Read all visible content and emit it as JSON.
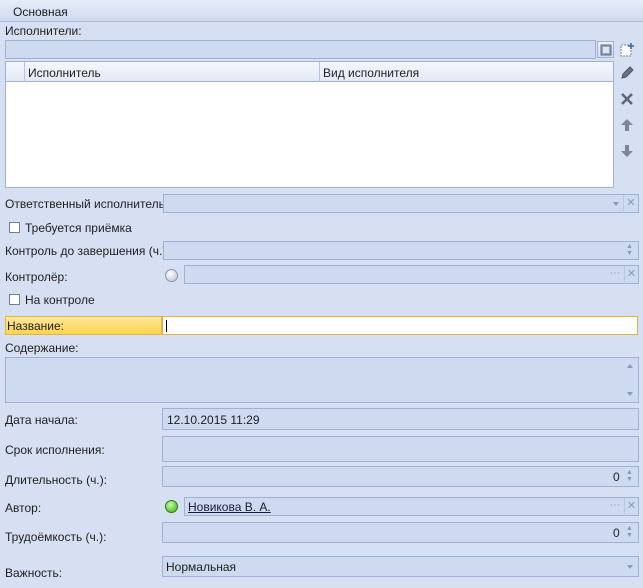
{
  "panel": {
    "title": "Основная"
  },
  "performers": {
    "label": "Исполнители:",
    "columns": [
      "Исполнитель",
      "Вид исполнителя"
    ],
    "rows": []
  },
  "responsible": {
    "label": "Ответственный исполнитель:",
    "value": ""
  },
  "acceptance": {
    "label": "Требуется приёмка",
    "checked": false
  },
  "control_until": {
    "label": "Контроль до завершения (ч.):",
    "value": ""
  },
  "controller": {
    "label": "Контролёр:",
    "value": ""
  },
  "on_control": {
    "label": "На контроле",
    "checked": false
  },
  "name": {
    "label": "Название:",
    "value": ""
  },
  "content": {
    "label": "Содержание:",
    "value": ""
  },
  "start_date": {
    "label": "Дата начала:",
    "value": "12.10.2015 11:29"
  },
  "due_date": {
    "label": "Срок исполнения:",
    "value": ""
  },
  "duration": {
    "label": "Длительность (ч.):",
    "value": "0"
  },
  "author": {
    "label": "Автор:",
    "value": "Новикова В. А."
  },
  "effort": {
    "label": "Трудоёмкость (ч.):",
    "value": "0"
  },
  "importance": {
    "label": "Важность:",
    "value": "Нормальная"
  },
  "icons": {
    "select_table": "table-select-icon",
    "add": "add-icon",
    "edit": "pencil-icon",
    "delete": "delete-icon",
    "up": "arrow-up-icon",
    "down": "arrow-down-icon",
    "status_online": "status-green",
    "status_offline": "status-gray"
  },
  "colors": {
    "background": "#d6e0f2",
    "field": "#cddaf0",
    "highlight": "#ffd452",
    "status_green": "#3fbf1f"
  }
}
